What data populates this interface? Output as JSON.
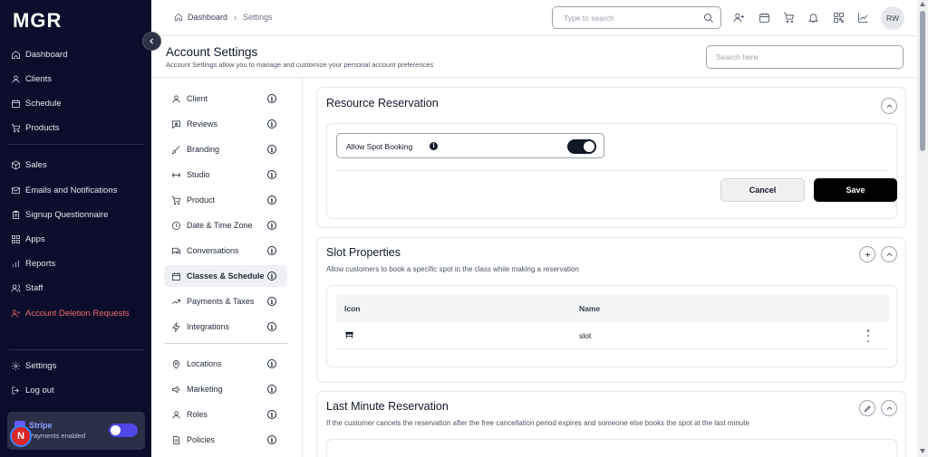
{
  "app": {
    "logo": "MGR"
  },
  "sidebar": {
    "items": [
      {
        "label": "Dashboard",
        "icon": "home-icon"
      },
      {
        "label": "Clients",
        "icon": "user-icon"
      },
      {
        "label": "Schedule",
        "icon": "calendar-icon"
      },
      {
        "label": "Products",
        "icon": "cart-icon"
      },
      {
        "label": "Sales",
        "icon": "box-icon"
      },
      {
        "label": "Emails and Notifications",
        "icon": "mail-icon"
      },
      {
        "label": "Signup Questionnaire",
        "icon": "clipboard-icon"
      },
      {
        "label": "Apps",
        "icon": "apps-icon"
      },
      {
        "label": "Reports",
        "icon": "bar-chart-icon"
      },
      {
        "label": "Staff",
        "icon": "staff-icon"
      },
      {
        "label": "Account Deletion Requests",
        "icon": "user-x-icon"
      }
    ],
    "bottom": [
      {
        "label": "Settings",
        "icon": "gear-icon"
      },
      {
        "label": "Log out",
        "icon": "logout-icon"
      }
    ],
    "stripe": {
      "title": "Stripe",
      "subtitle": "Payments enabled",
      "enabled": true
    },
    "badge": "N"
  },
  "topbar": {
    "breadcrumb": {
      "home": "Dashboard",
      "current": "Settings"
    },
    "search_placeholder": "Type to search",
    "avatar": "RW",
    "icons": [
      "add-user-icon",
      "calendar-icon",
      "cart-icon",
      "bell-icon",
      "qr-icon",
      "trend-icon"
    ]
  },
  "page": {
    "title": "Account Settings",
    "subtitle": "Account Settings allow you to manage and customize your personal account preferences",
    "search_placeholder": "Search here"
  },
  "settings_menu": {
    "items": [
      {
        "label": "Client",
        "icon": "person-icon"
      },
      {
        "label": "Reviews",
        "icon": "review-icon"
      },
      {
        "label": "Branding",
        "icon": "brush-icon"
      },
      {
        "label": "Studio",
        "icon": "dumbbell-icon"
      },
      {
        "label": "Product",
        "icon": "cart-icon"
      },
      {
        "label": "Date & Time Zone",
        "icon": "clock-icon"
      },
      {
        "label": "Conversations",
        "icon": "chat-icon"
      },
      {
        "label": "Classes & Schedule",
        "icon": "calendar-icon",
        "active": true
      },
      {
        "label": "Payments & Taxes",
        "icon": "trend-icon"
      },
      {
        "label": "Integrations",
        "icon": "bolt-icon"
      },
      {
        "label": "Locations",
        "icon": "pin-icon"
      },
      {
        "label": "Marketing",
        "icon": "megaphone-icon"
      },
      {
        "label": "Roles",
        "icon": "person-icon"
      },
      {
        "label": "Policies",
        "icon": "policy-icon"
      }
    ]
  },
  "resource_reservation": {
    "title": "Resource Reservation",
    "allow_spot_booking": {
      "label": "Allow Spot Booking",
      "enabled": true
    },
    "cancel_label": "Cancel",
    "save_label": "Save"
  },
  "slot_properties": {
    "title": "Slot Properties",
    "subtitle": "Allow customers to book a specific spot in the class while making a reservation",
    "columns": [
      "Icon",
      "Name"
    ],
    "rows": [
      {
        "icon": "slot-icon",
        "name": "slot"
      }
    ]
  },
  "last_minute": {
    "title": "Last Minute Reservation",
    "subtitle": "If the customer cancels the reservation after the free cancellation period expires and someone else books the spot at the last minute"
  }
}
